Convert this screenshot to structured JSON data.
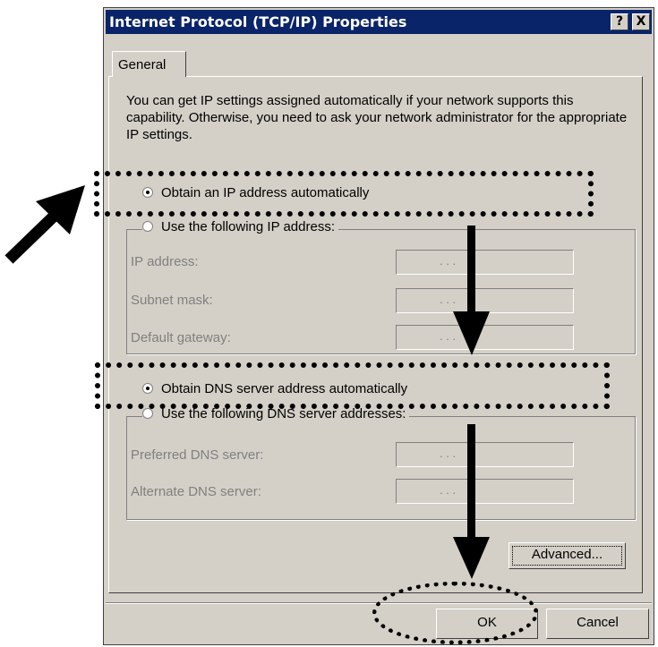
{
  "dialog": {
    "title": "Internet Protocol (TCP/IP) Properties",
    "help_button": "?",
    "close_button": "X",
    "tab_general": "General",
    "description": "You can get IP settings assigned automatically if your network supports this capability. Otherwise, you need to ask your network administrator for the appropriate IP settings.",
    "ip_auto_label": "Obtain an IP address automatically",
    "ip_manual_label": "Use the following IP address:",
    "ip_fields": [
      {
        "label": "IP address:",
        "value": ". . ."
      },
      {
        "label": "Subnet mask:",
        "value": ". . ."
      },
      {
        "label": "Default gateway:",
        "value": ". . ."
      }
    ],
    "dns_auto_label": "Obtain DNS server address automatically",
    "dns_manual_label": "Use the following DNS server addresses:",
    "dns_fields": [
      {
        "label": "Preferred DNS server:",
        "value": ". . ."
      },
      {
        "label": "Alternate DNS server:",
        "value": ". . ."
      }
    ],
    "advanced_label": "Advanced...",
    "ok_label": "OK",
    "cancel_label": "Cancel"
  },
  "colors": {
    "titlebar": "#0a246a",
    "face": "#d4d0c8",
    "annotation": "#000000"
  },
  "annotations": [
    "arrow-icon",
    "arrow-down-icon",
    "dotted-highlight"
  ]
}
